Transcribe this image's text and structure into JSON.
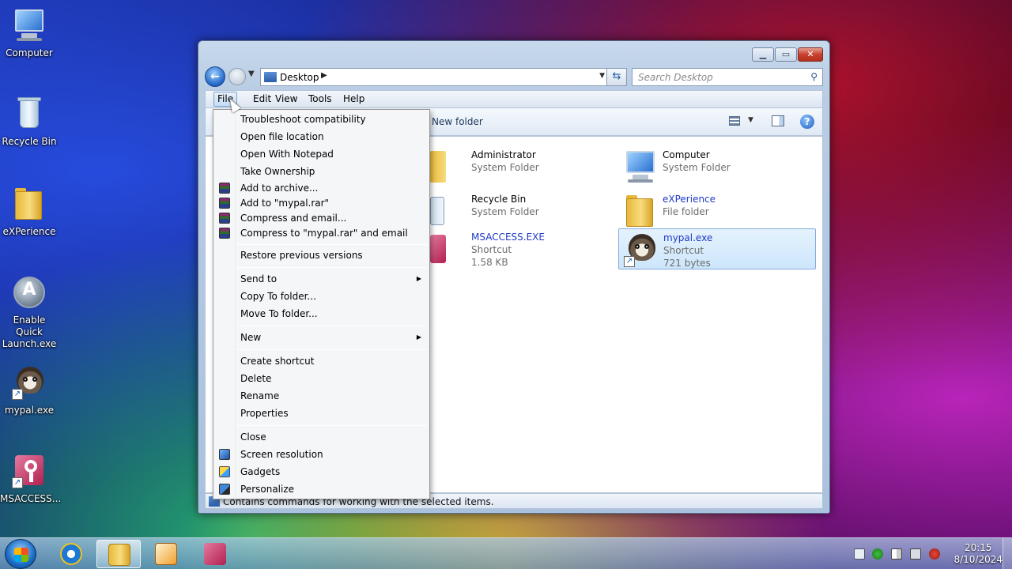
{
  "desktop": {
    "icons": [
      {
        "label": "Computer"
      },
      {
        "label": "Recycle Bin"
      },
      {
        "label": "eXPerience"
      },
      {
        "label": "Enable Quick Launch.exe"
      },
      {
        "label": "mypal.exe"
      },
      {
        "label": "MSACCESS..."
      }
    ]
  },
  "explorer": {
    "address": "Desktop",
    "search_placeholder": "Search Desktop",
    "menu": [
      "File",
      "Edit",
      "View",
      "Tools",
      "Help"
    ],
    "toolbar": {
      "new_folder": "New folder"
    },
    "items": [
      {
        "name": "Administrator",
        "type": "System Folder",
        "size": ""
      },
      {
        "name": "Computer",
        "type": "System Folder",
        "size": ""
      },
      {
        "name": "Recycle Bin",
        "type": "System Folder",
        "size": ""
      },
      {
        "name": "eXPerience",
        "type": "File folder",
        "size": ""
      },
      {
        "name": "MSACCESS.EXE",
        "type": "Shortcut",
        "size": "1.58 KB"
      },
      {
        "name": "mypal.exe",
        "type": "Shortcut",
        "size": "721 bytes"
      }
    ],
    "status": "Contains commands for working with the selected items."
  },
  "file_menu": {
    "items": [
      {
        "label": "Troubleshoot compatibility"
      },
      {
        "label": "Open file location"
      },
      {
        "label": "Open With Notepad"
      },
      {
        "label": "Take Ownership"
      },
      {
        "label": "Add to archive...",
        "icon": "winrar-icon"
      },
      {
        "label": "Add to \"mypal.rar\"",
        "icon": "winrar-icon"
      },
      {
        "label": "Compress and email...",
        "icon": "winrar-icon"
      },
      {
        "label": "Compress to \"mypal.rar\" and email",
        "icon": "winrar-icon"
      },
      {
        "label": "Restore previous versions"
      },
      {
        "label": "Send to",
        "submenu": true
      },
      {
        "label": "Copy To folder..."
      },
      {
        "label": "Move To folder..."
      },
      {
        "label": "New",
        "submenu": true
      },
      {
        "label": "Create shortcut"
      },
      {
        "label": "Delete"
      },
      {
        "label": "Rename"
      },
      {
        "label": "Properties"
      },
      {
        "label": "Close"
      },
      {
        "label": "Screen resolution",
        "icon": "screen-resolution-icon"
      },
      {
        "label": "Gadgets",
        "icon": "gadgets-icon"
      },
      {
        "label": "Personalize",
        "icon": "personalize-icon"
      }
    ]
  },
  "taskbar": {
    "time": "20:15",
    "date": "8/10/2024"
  }
}
